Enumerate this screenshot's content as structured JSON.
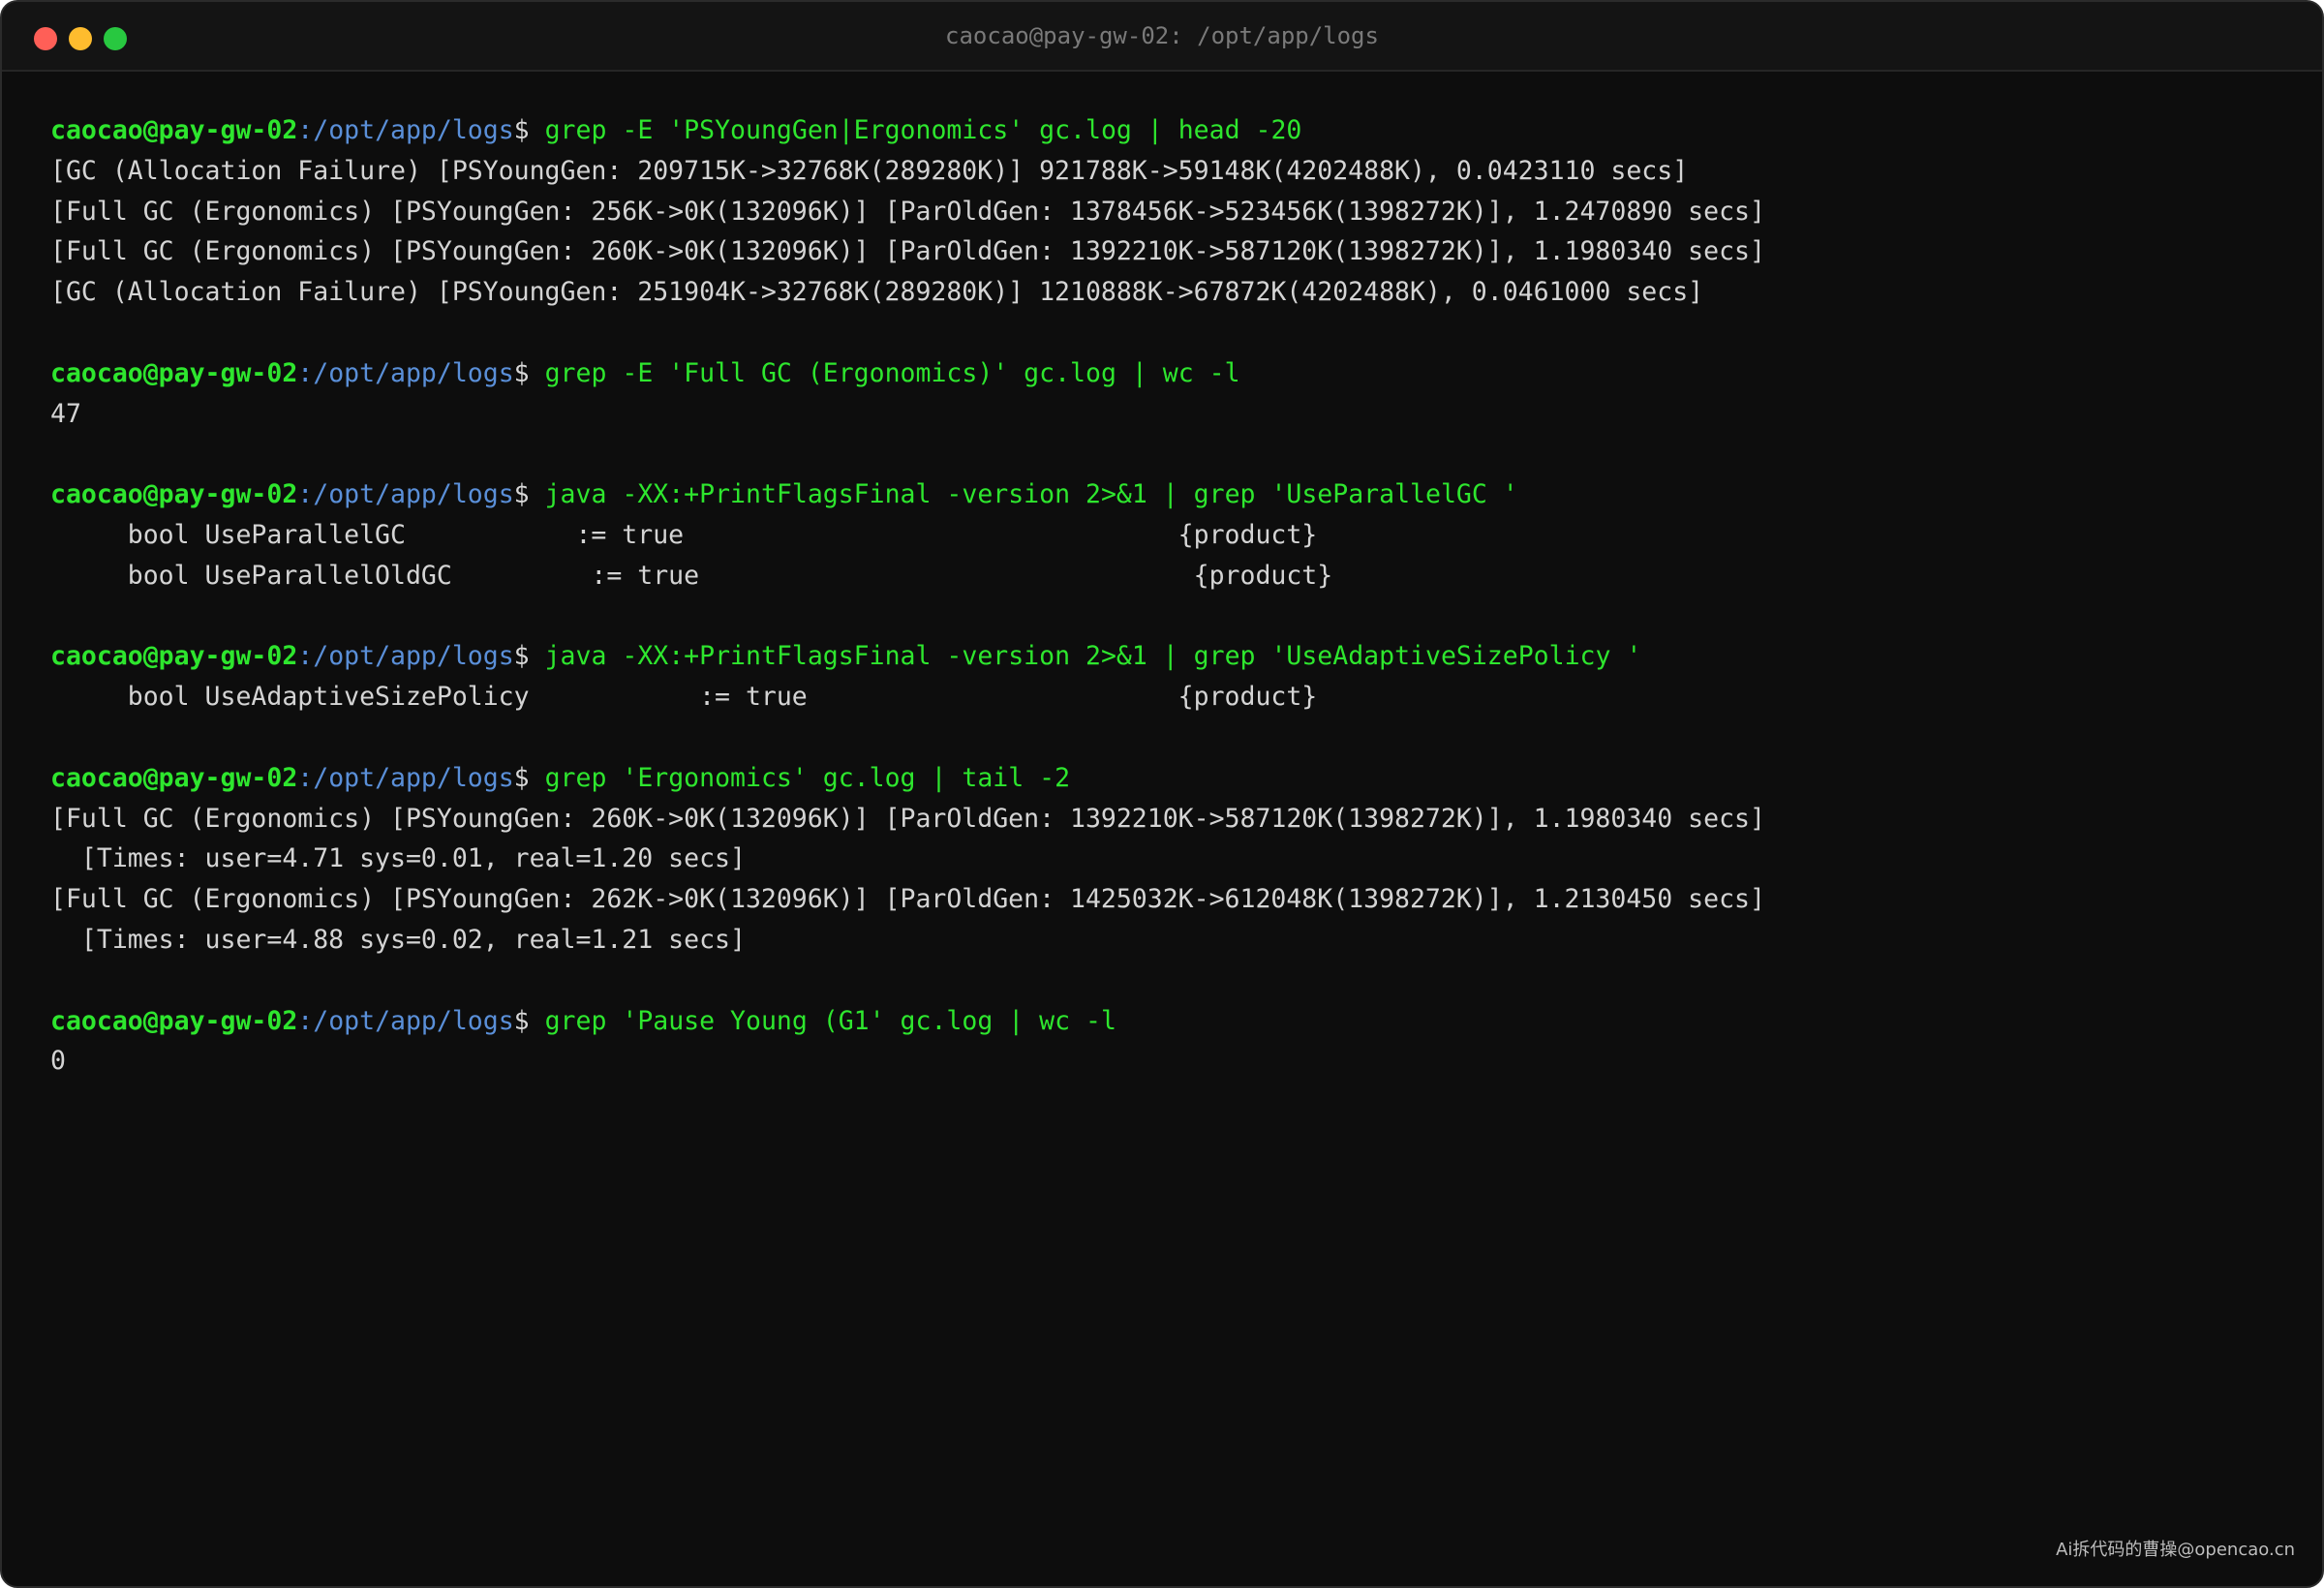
{
  "window": {
    "title": "caocao@pay-gw-02: /opt/app/logs"
  },
  "prompt": {
    "user": "caocao@pay-gw-02",
    "colon": ":",
    "path": "/opt/app/logs",
    "dollar": "$ "
  },
  "blocks": [
    {
      "command": "grep -E 'PSYoungGen|Ergonomics' gc.log | head -20",
      "output": [
        "[GC (Allocation Failure) [PSYoungGen: 209715K->32768K(289280K)] 921788K->59148K(4202488K), 0.0423110 secs]",
        "[Full GC (Ergonomics) [PSYoungGen: 256K->0K(132096K)] [ParOldGen: 1378456K->523456K(1398272K)], 1.2470890 secs]",
        "[Full GC (Ergonomics) [PSYoungGen: 260K->0K(132096K)] [ParOldGen: 1392210K->587120K(1398272K)], 1.1980340 secs]",
        "[GC (Allocation Failure) [PSYoungGen: 251904K->32768K(289280K)] 1210888K->67872K(4202488K), 0.0461000 secs]"
      ]
    },
    {
      "command": "grep -E 'Full GC (Ergonomics)' gc.log | wc -l",
      "output": [
        "47"
      ]
    },
    {
      "command": "java -XX:+PrintFlagsFinal -version 2>&1 | grep 'UseParallelGC '",
      "output": [
        "     bool UseParallelGC           := true                                {product}",
        "     bool UseParallelOldGC         := true                                {product}"
      ]
    },
    {
      "command": "java -XX:+PrintFlagsFinal -version 2>&1 | grep 'UseAdaptiveSizePolicy '",
      "output": [
        "     bool UseAdaptiveSizePolicy           := true                        {product}"
      ]
    },
    {
      "command": "grep 'Ergonomics' gc.log | tail -2",
      "output": [
        "[Full GC (Ergonomics) [PSYoungGen: 260K->0K(132096K)] [ParOldGen: 1392210K->587120K(1398272K)], 1.1980340 secs]",
        "  [Times: user=4.71 sys=0.01, real=1.20 secs]",
        "[Full GC (Ergonomics) [PSYoungGen: 262K->0K(132096K)] [ParOldGen: 1425032K->612048K(1398272K)], 1.2130450 secs]",
        "  [Times: user=4.88 sys=0.02, real=1.21 secs]"
      ]
    },
    {
      "command": "grep 'Pause Young (G1' gc.log | wc -l",
      "output": [
        "0"
      ]
    }
  ],
  "watermark": "Ai拆代码的曹操@opencao.cn"
}
